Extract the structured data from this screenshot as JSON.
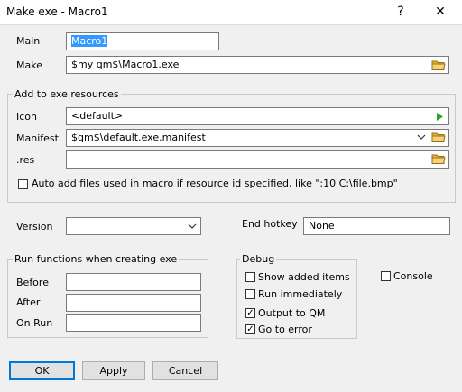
{
  "window": {
    "title": "Make exe - Macro1",
    "help_label": "?",
    "close_label": "✕"
  },
  "main": {
    "main_label": "Main",
    "main_value": "Macro1",
    "make_label": "Make",
    "make_value": "$my qm$\\Macro1.exe"
  },
  "resources": {
    "group_title": "Add to exe resources",
    "icon_label": "Icon",
    "icon_value": "<default>",
    "manifest_label": "Manifest",
    "manifest_value": "$qm$\\default.exe.manifest",
    "res_label": ".res",
    "res_value": "",
    "auto_add_label": "Auto add files used in macro if resource id specified, like \":10 C:\\file.bmp\"",
    "auto_add_checked": false
  },
  "version": {
    "label": "Version",
    "value": ""
  },
  "end_hotkey": {
    "label": "End hotkey",
    "value": "None"
  },
  "run_functions": {
    "group_title": "Run functions when creating exe",
    "before_label": "Before",
    "before_value": "",
    "after_label": "After",
    "after_value": "",
    "onrun_label": "On Run",
    "onrun_value": ""
  },
  "debug": {
    "group_title": "Debug",
    "items": [
      {
        "label": "Show added items",
        "checked": false
      },
      {
        "label": "Run immediately",
        "checked": false
      },
      {
        "label": "Output to QM",
        "checked": true
      },
      {
        "label": "Go to error",
        "checked": true
      }
    ]
  },
  "console": {
    "label": "Console",
    "checked": false
  },
  "buttons": {
    "ok": "OK",
    "apply": "Apply",
    "cancel": "Cancel"
  },
  "colors": {
    "accent": "#0078d7",
    "selection": "#3399ff",
    "folder": "#e8b43c",
    "play": "#2aa52a"
  }
}
